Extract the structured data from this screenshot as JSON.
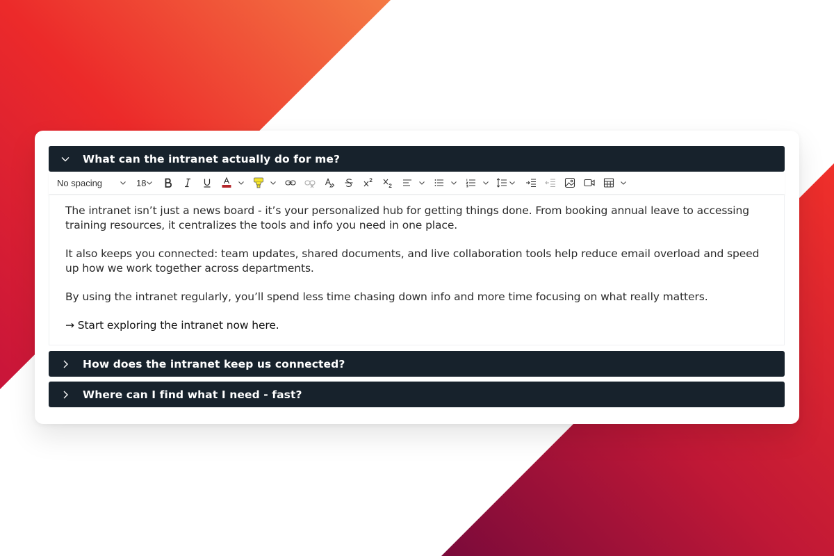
{
  "accordion": [
    {
      "title": "What can the intranet actually do for me?",
      "expanded": true
    },
    {
      "title": "How does the intranet keep us connected?",
      "expanded": false
    },
    {
      "title": "Where can I find what I need - fast?",
      "expanded": false
    }
  ],
  "toolbar": {
    "style_value": "No spacing",
    "size_value": "18",
    "font_color": "#b3262a",
    "highlight_color": "#f5e52a"
  },
  "editor": {
    "paragraphs": [
      "The intranet isn’t just a news board - it’s your personalized hub for getting things done. From booking annual leave to accessing training resources, it centralizes the tools and info you need in one place.",
      "It also keeps you connected: team updates, shared documents, and live collaboration tools help reduce email overload and speed up how we work together across departments.",
      "By using the intranet regularly, you’ll spend less time chasing down info and more time focusing on what really matters."
    ],
    "link_arrow": "→",
    "link_text": "Start exploring the intranet now here."
  },
  "colors": {
    "header_bg": "#17222c",
    "accent_red": "#e8222b",
    "accent_orange": "#f26b3a"
  }
}
